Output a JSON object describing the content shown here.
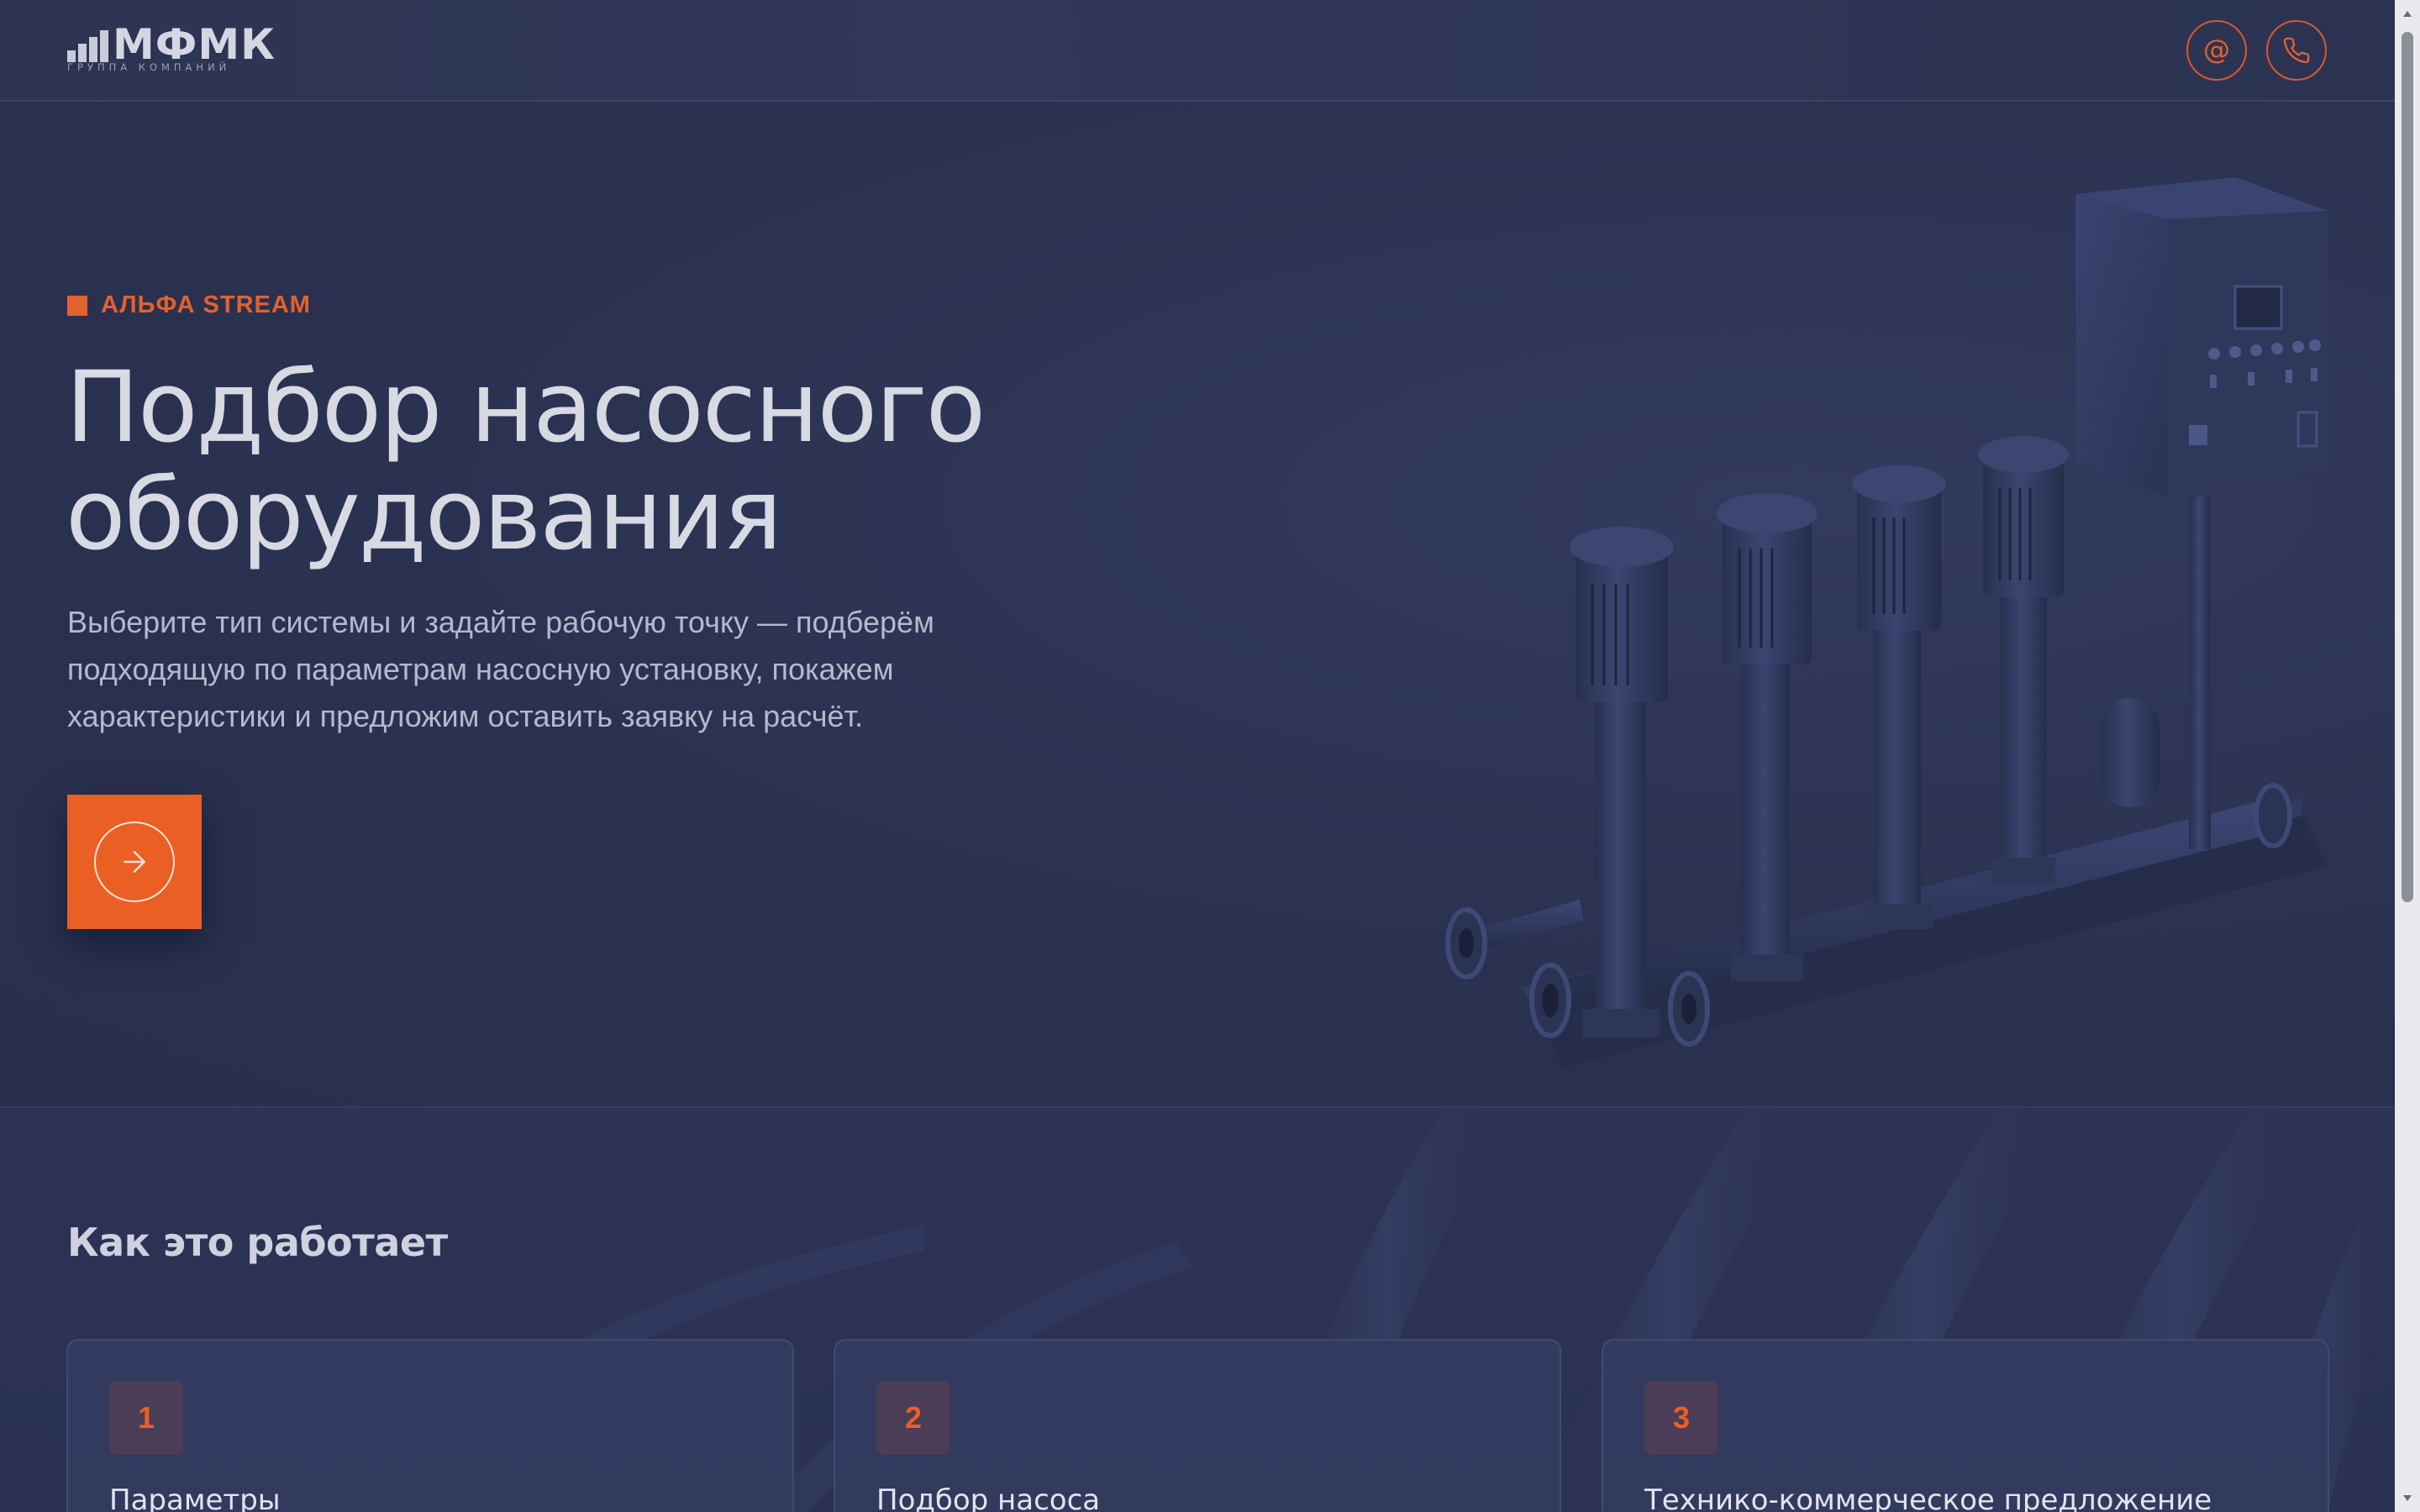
{
  "header": {
    "logo_title": "МФМК",
    "logo_subtitle": "ГРУППА КОМПАНИЙ",
    "email_icon_glyph": "@",
    "icons": [
      "logo-bars-icon",
      "email-icon",
      "phone-icon"
    ]
  },
  "hero": {
    "tag": "АЛЬФА STREAM",
    "title_lines": [
      "Подбор насосного",
      "оборудования"
    ],
    "description_lines": [
      "Выберите тип системы и задайте рабочую точку — подберём",
      "подходящую по параметрам насосную установку, покажем",
      "характеристики и предложим оставить заявку на расчёт."
    ],
    "cta_icon": "arrow-right-icon",
    "image": "pump-station-image"
  },
  "how": {
    "title": "Как это работает",
    "cards": [
      {
        "number": "1",
        "title": "Параметры"
      },
      {
        "number": "2",
        "title": "Подбор насоса"
      },
      {
        "number": "3",
        "title": "Технико-коммерческое предложение"
      }
    ]
  },
  "colors": {
    "background": "#2b3150",
    "accent": "#ea5f24",
    "text_primary": "#d7d9e3",
    "text_secondary": "#b5b9cc",
    "card_bg": "#333b61"
  }
}
